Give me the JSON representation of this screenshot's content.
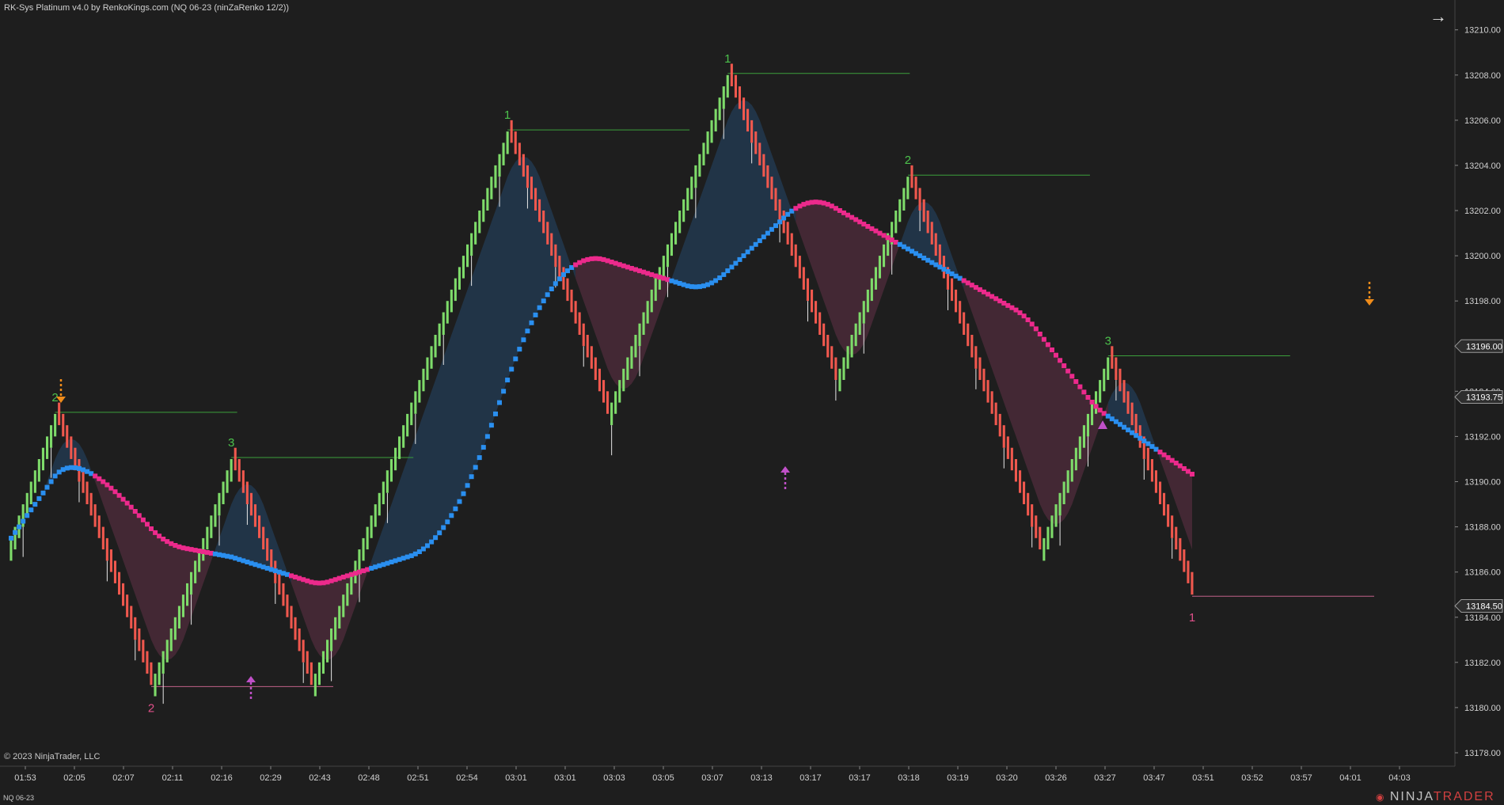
{
  "header": {
    "title": "RK-Sys Platinum v4.0 by RenkoKings.com (NQ 06-23 (ninZaRenko 12/2))"
  },
  "footer": {
    "copyright": "© 2023 NinjaTrader, LLC",
    "instrument": "NQ 06-23",
    "logo_part1": "NINJA",
    "logo_part2": "TRADER"
  },
  "icons": {
    "panel_toggle": "arrow-right-icon",
    "logo_mark": "ninjatrader-logo-icon"
  },
  "colors": {
    "background": "#1e1e1e",
    "up_bar": "#7edb6a",
    "down_bar": "#f0584e",
    "ma_bull": "#2a8ff0",
    "ma_bear": "#ec2a8c",
    "cloud_bull": "#22384f",
    "cloud_bear": "#4a2a38",
    "swing_high_line": "#3ca03c",
    "swing_low_line": "#c06088",
    "signal_arrow": "#f08c1a",
    "trigger_arrow": "#c050c8"
  },
  "chart_data": {
    "type": "candlestick",
    "renko_brick_size": 0.5,
    "ylim": [
      13176.0,
      13211.5
    ],
    "y_ticks": [
      13178.0,
      13180.0,
      13182.0,
      13184.0,
      13186.0,
      13188.0,
      13190.0,
      13192.0,
      13194.0,
      13196.0,
      13198.0,
      13200.0,
      13202.0,
      13204.0,
      13206.0,
      13208.0,
      13210.0
    ],
    "price_labels": [
      {
        "value": "13196.00",
        "y": 13196.0
      },
      {
        "value": "13193.75",
        "y": 13193.75
      },
      {
        "value": "13184.50",
        "y": 13184.5
      }
    ],
    "x_tick_labels": [
      "01:53",
      "02:05",
      "02:07",
      "02:11",
      "02:16",
      "02:29",
      "02:43",
      "02:48",
      "02:51",
      "02:54",
      "03:01",
      "03:01",
      "03:03",
      "03:05",
      "03:07",
      "03:13",
      "03:17",
      "03:17",
      "03:18",
      "03:19",
      "03:20",
      "03:26",
      "03:27",
      "03:47",
      "03:51",
      "03:52",
      "03:57",
      "04:01",
      "04:03"
    ],
    "legs": [
      {
        "start": 13187.0,
        "end": 13193.0
      },
      {
        "start": 13193.0,
        "end": 13181.0
      },
      {
        "start": 13181.0,
        "end": 13191.0
      },
      {
        "start": 13191.0,
        "end": 13181.0
      },
      {
        "start": 13181.0,
        "end": 13205.5
      },
      {
        "start": 13205.5,
        "end": 13193.0
      },
      {
        "start": 13193.0,
        "end": 13208.0
      },
      {
        "start": 13208.0,
        "end": 13194.5
      },
      {
        "start": 13194.5,
        "end": 13203.5
      },
      {
        "start": 13203.5,
        "end": 13187.0
      },
      {
        "start": 13187.0,
        "end": 13195.5
      },
      {
        "start": 13195.5,
        "end": 13185.0
      }
    ],
    "swing_labels": [
      {
        "text": "2",
        "y": 13192.5,
        "kind": "high"
      },
      {
        "text": "2",
        "y": 13180.0,
        "kind": "low"
      },
      {
        "text": "3",
        "y": 13191.5,
        "kind": "high"
      },
      {
        "text": "1",
        "y": 13206.5,
        "kind": "high"
      },
      {
        "text": "1",
        "y": 13210.0,
        "kind": "high"
      },
      {
        "text": "2",
        "y": 13203.5,
        "kind": "high"
      },
      {
        "text": "3",
        "y": 13195.5,
        "kind": "high"
      },
      {
        "text": "1",
        "y": 13185.0,
        "kind": "low"
      }
    ],
    "levels": [
      {
        "y": 13192.0,
        "kind": "high"
      },
      {
        "y": 13191.0,
        "kind": "high"
      },
      {
        "y": 13206.0,
        "kind": "high"
      },
      {
        "y": 13210.0,
        "kind": "high"
      },
      {
        "y": 13204.0,
        "kind": "high"
      },
      {
        "y": 13196.0,
        "kind": "high"
      },
      {
        "y": 13180.5,
        "kind": "low"
      },
      {
        "y": 13191.5,
        "kind": "low"
      },
      {
        "y": 13186.0,
        "kind": "low"
      },
      {
        "y": 13197.0,
        "kind": "high"
      },
      {
        "y": 13179.0,
        "kind": "low"
      }
    ]
  }
}
